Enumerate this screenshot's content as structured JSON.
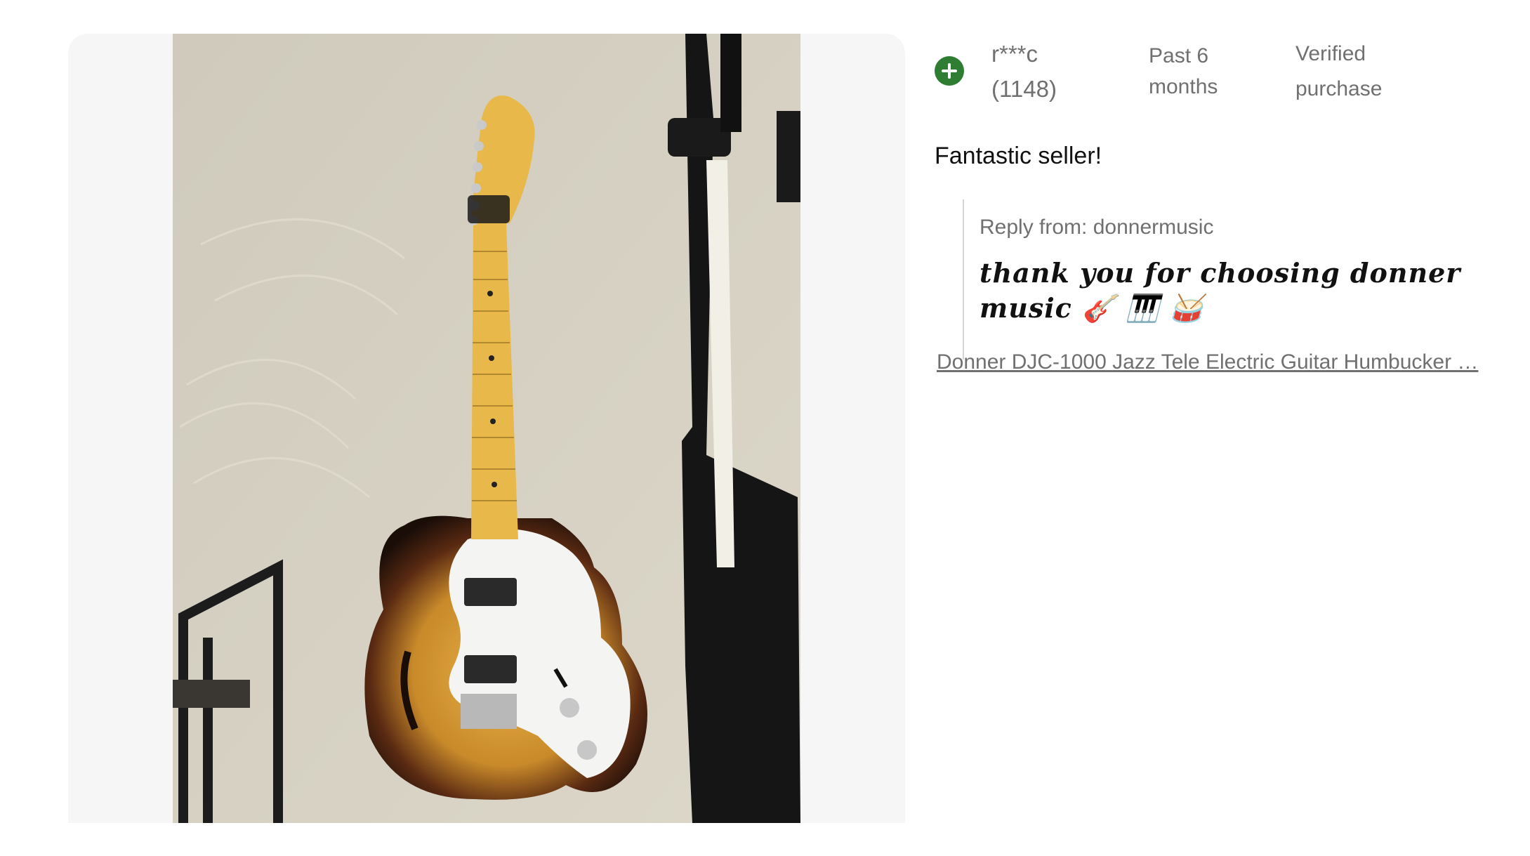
{
  "review": {
    "reviewer_name": "r***c",
    "reviewer_score": "(1148)",
    "time_period": "Past 6 months",
    "verified_label": "Verified purchase",
    "text": "Fantastic seller!",
    "reply_from": "Reply from: donnermusic",
    "reply_message": "thank you for choosing donner music 🎸 🎹 🥁",
    "product_link": "Donner DJC-1000 Jazz Tele Electric Guitar Humbucker …"
  },
  "icons": {
    "expand": "plus-circle-icon"
  },
  "colors": {
    "accent_green": "#2e7d32",
    "muted_text": "#707070",
    "panel_bg": "#f6f6f6"
  }
}
